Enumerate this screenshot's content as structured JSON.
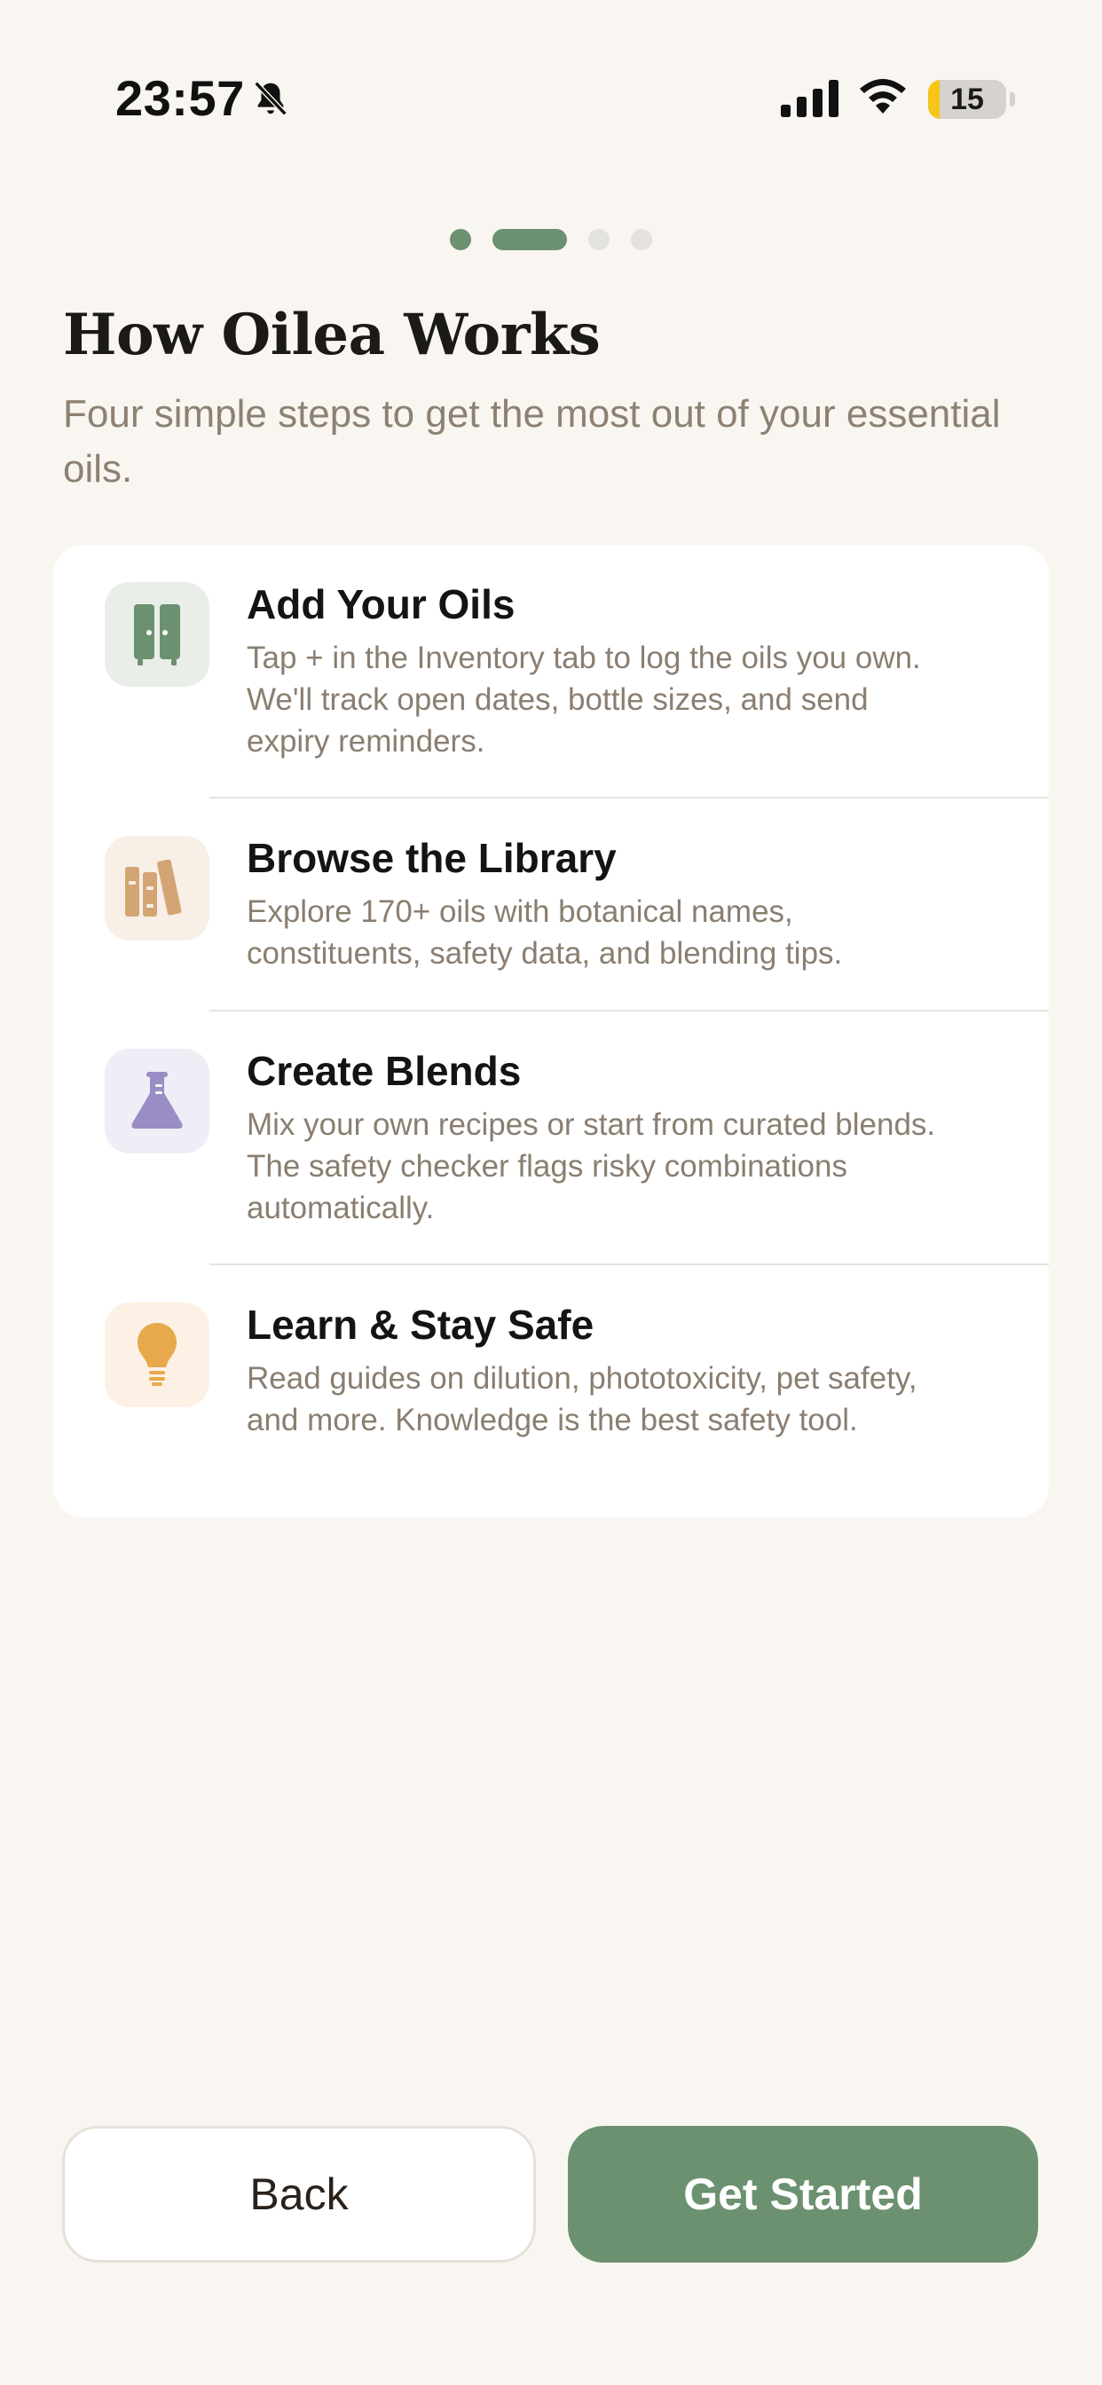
{
  "status_bar": {
    "time": "23:57",
    "battery_level": "15",
    "battery_fraction": 0.15,
    "icons": [
      "bell-slash-icon",
      "cellular-signal-icon",
      "wifi-icon",
      "battery-icon"
    ]
  },
  "pager": {
    "total_pages": 4,
    "current_page": 2
  },
  "header": {
    "title": "How Oilea Works",
    "subtitle": "Four simple steps to get the most out of your essential oils."
  },
  "steps": [
    {
      "title": "Add Your Oils",
      "description": "Tap + in the Inventory tab to log the oils you own. We'll track open dates, bottle sizes, and send expiry reminders.",
      "icon": "cabinet-icon",
      "icon_color": "#6b9170",
      "icon_bg": "#e9eee8"
    },
    {
      "title": "Browse the Library",
      "description": "Explore 170+ oils with botanical names, constituents, safety data, and blending tips.",
      "icon": "books-icon",
      "icon_color": "#d4a574",
      "icon_bg": "#f8efe6"
    },
    {
      "title": "Create Blends",
      "description": "Mix your own recipes or start from curated blends. The safety checker flags risky combinations automatically.",
      "icon": "flask-icon",
      "icon_color": "#9a8cc4",
      "icon_bg": "#efedf5"
    },
    {
      "title": "Learn & Stay Safe",
      "description": "Read guides on dilution, phototoxicity, pet safety, and more. Knowledge is the best safety tool.",
      "icon": "lightbulb-icon",
      "icon_color": "#e8a84c",
      "icon_bg": "#fcf1e4"
    }
  ],
  "buttons": {
    "back": "Back",
    "get_started": "Get Started"
  },
  "colors": {
    "background": "#f9f6f1",
    "accent": "#6b9170",
    "text_secondary": "#8a7e70"
  }
}
